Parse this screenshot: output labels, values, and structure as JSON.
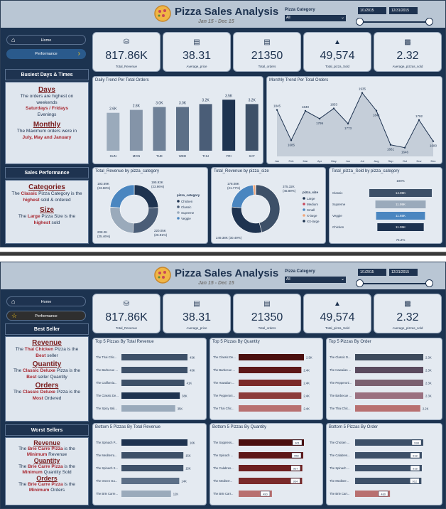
{
  "header": {
    "title": "Pizza Sales Analysis",
    "subtitle": "Jan 15 - Dec 15",
    "filter_label": "Pizza Category",
    "filter_value": "All",
    "date_start": "1/1/2015",
    "date_end": "12/31/2015"
  },
  "nav": {
    "home": "Home",
    "performance": "Performance"
  },
  "kpis": [
    {
      "value": "817.86K",
      "label": "Total_Revenue",
      "icon": "money-bag-icon"
    },
    {
      "value": "38.31",
      "label": "Average_price",
      "icon": "receipt-icon"
    },
    {
      "value": "21350",
      "label": "Total_orders",
      "icon": "clipboard-icon"
    },
    {
      "value": "49,574",
      "label": "Total_pizza_Sold",
      "icon": "pizza-slice-icon"
    },
    {
      "value": "2.32",
      "label": "Average_pizzas_sold",
      "icon": "bar-chart-icon"
    }
  ],
  "page1": {
    "side1_head": "Busiest Days & Times",
    "days_title": "Days",
    "days_text1": "The orders are highest on weekends",
    "days_red": "Saturdays / Fridays",
    "days_text2": "Evenings",
    "monthly_title": "Monthly",
    "monthly_text": "The Maximum orders were in",
    "monthly_red": "July, May and January",
    "side2_head": "Sales Performance",
    "cat_title": "Categories",
    "cat_t1": "The ",
    "cat_red1": "Classic",
    "cat_t2": " Pizza Category is the ",
    "cat_red2": "highest",
    "cat_t3": " sold & ordered",
    "size_title": "Size",
    "size_t1": "The ",
    "size_red1": "Large",
    "size_t2": " Pizza Size is the ",
    "size_red2": "highest",
    "size_t3": " sold"
  },
  "page2": {
    "side1_head": "Best Seller",
    "rev_title": "Revenue",
    "rev_t1": "The ",
    "rev_red": "Thai Chicken",
    "rev_t2": " Pizza is the ",
    "rev_red2": "Best",
    "rev_t3": " seller",
    "qty_title": "Quantity",
    "qty_t1": "The ",
    "qty_red": "Classic Deluxe",
    "qty_t2": " Pizza is the ",
    "qty_red2": "Best",
    "qty_t3": " seller Quantity",
    "ord_title": "Orders",
    "ord_t1": "The ",
    "ord_red": "Classic Deluxe",
    "ord_t2": " Pizza is the ",
    "ord_red2": "Most",
    "ord_t3": " Ordered",
    "side2_head": "Worst Sellers",
    "wrev_title": "Revenue",
    "wrev_t1": "The ",
    "wrev_red": "Brie Carre Pizza",
    "wrev_t2": " is the ",
    "wrev_red2": "Minimum",
    "wrev_t3": " Revenue",
    "wqty_title": "Quantity",
    "wqty_t1": "The ",
    "wqty_red": "Brie Carre Pizza",
    "wqty_t2": " is the ",
    "wqty_red2": "Minimum",
    "wqty_t3": " Quantity Sold",
    "word_title": "Orders",
    "word_t1": "The ",
    "word_red": "Brie Carre Pizza",
    "word_t2": " is the ",
    "word_red2": "Minimum",
    "word_t3": " Orders"
  },
  "chart_data": [
    {
      "type": "bar",
      "title": "Daily Trend Per Total Orders",
      "categories": [
        "SUN",
        "MON",
        "TUE",
        "WED",
        "THU",
        "FRI",
        "SAT"
      ],
      "values": [
        2.6,
        2.8,
        3.0,
        3.0,
        3.2,
        3.5,
        3.2
      ],
      "labels": [
        "2.6K",
        "2.8K",
        "3.0K",
        "3.0K",
        "3.2K",
        "3.5K",
        "3.2K"
      ],
      "unit": "K",
      "colors": [
        "#9aaabb",
        "#8494a8",
        "#6f8198",
        "#5c6f87",
        "#4a5d77",
        "#1e3350",
        "#3d5068"
      ]
    },
    {
      "type": "area",
      "title": "Monthly Trend Per Total Orders",
      "categories": [
        "Jan",
        "Feb",
        "Mar",
        "Apr",
        "May",
        "Jun",
        "Jul",
        "Aug",
        "Sep",
        "Oct",
        "Nov",
        "Dec"
      ],
      "values": [
        1845,
        1685,
        1840,
        1799,
        1853,
        1773,
        1935,
        1841,
        1661,
        1646,
        1792,
        1680
      ],
      "ylim": [
        1600,
        1960
      ]
    },
    {
      "type": "pie",
      "title": "Total_Revenue by pizza_category",
      "legend_title": "pizza_category",
      "legend": [
        "Chicken",
        "Classic",
        "Supreme",
        "Veggie"
      ],
      "values": [
        195.92,
        220.05,
        208.2,
        193.69
      ],
      "labels": [
        "195.92K\n(23.96%)",
        "220.05K\n(26.91%)",
        "208.2K\n(25.46%)",
        "193.69K\n(23.68%)"
      ],
      "colors": [
        "#1e3350",
        "#4a5d77",
        "#9aaabb",
        "#4a86c0"
      ]
    },
    {
      "type": "pie",
      "title": "Total_Revenue by pizza_size",
      "legend_title": "pizza_size",
      "legend": [
        "Large",
        "Medium",
        "Small",
        "X-large",
        "XX-large"
      ],
      "values": [
        375.32,
        249.38,
        178.08,
        14.08,
        1.01
      ],
      "labels": [
        "375.32K\n(45.89%)",
        "249.38K (30.49%)",
        "178.08K\n(21.77%)"
      ],
      "colors": [
        "#3d5068",
        "#1e3350",
        "#4a86c0",
        "#f0a67a",
        "#1e3350"
      ],
      "legend_colors": [
        "#1e3350",
        "#c8465a",
        "#4a86c0",
        "#f0a67a",
        "#1e3350"
      ]
    },
    {
      "type": "bar",
      "title": "Total_pizza_Sold by pizza_category",
      "categories": [
        "Classic",
        "Supreme",
        "Veggie",
        "Chicken"
      ],
      "values": [
        14.89,
        11.99,
        11.65,
        11.05
      ],
      "labels": [
        "14.89K",
        "11.99K",
        "11.65K",
        "11.05K"
      ],
      "top_label": "100%",
      "bottom_label": "74.2%",
      "colors": [
        "#3d5068",
        "#9aaabb",
        "#4a86c0",
        "#1e3350"
      ]
    },
    {
      "type": "bar",
      "title": "Top 5 Pizzas By Total Revenue",
      "categories": [
        "The Thai Chic...",
        "The Barbecue ...",
        "The California...",
        "The Classic De...",
        "The Spicy Itali..."
      ],
      "values": [
        43,
        43,
        41,
        38,
        35
      ],
      "labels": [
        "43K",
        "43K",
        "41K",
        "38K",
        "35K"
      ],
      "colors": [
        "#3d5068",
        "#3d5068",
        "#3d5068",
        "#1e3350",
        "#9aaabb"
      ]
    },
    {
      "type": "bar",
      "title": "Top 5 Pizzas By Quantity",
      "categories": [
        "The Classic De...",
        "The Barbecue ...",
        "The Hawaiian ...",
        "The Pepperoni...",
        "The Thai Chic..."
      ],
      "values": [
        2.5,
        2.4,
        2.4,
        2.4,
        2.4
      ],
      "labels": [
        "2.5K",
        "2.4K",
        "2.4K",
        "2.4K",
        "2.4K"
      ],
      "colors": [
        "#4a0f0f",
        "#5e1818",
        "#7a2a2a",
        "#8c3c3c",
        "#b87070"
      ]
    },
    {
      "type": "bar",
      "title": "Top 5 Pizzas By Order",
      "categories": [
        "The Classic D...",
        "The Hawaiian ...",
        "The Pepperoni...",
        "The Barbecue ...",
        "The Thai Chic..."
      ],
      "values": [
        2.3,
        2.3,
        2.3,
        2.3,
        2.2
      ],
      "labels": [
        "2.3K",
        "2.3K",
        "2.3K",
        "2.3K",
        "2.2K"
      ],
      "colors": [
        "#3d4a5c",
        "#5a4a5e",
        "#7a6070",
        "#9a7080",
        "#b87070"
      ]
    },
    {
      "type": "bar",
      "title": "Bottom 5 Pizzas By Total Revenue",
      "categories": [
        "The Spinach P...",
        "The Mediterra...",
        "The Spinach S...",
        "The Green Ga...",
        "The Brie Carre..."
      ],
      "values": [
        16,
        15,
        15,
        14,
        12
      ],
      "labels": [
        "16K",
        "15K",
        "15K",
        "14K",
        "12K"
      ],
      "colors": [
        "#1e3350",
        "#3d5068",
        "#3d5068",
        "#5c6f87",
        "#9aaabb"
      ]
    },
    {
      "type": "bar",
      "title": "Bottom 5 Pizzas By Quantity",
      "categories": [
        "The Soppress...",
        "The Spinach ...",
        "The Calabres...",
        "The Mediterr...",
        "The Brie Carr..."
      ],
      "values": [
        961,
        950,
        937,
        934,
        490
      ],
      "labels": [
        "961",
        "950",
        "937",
        "934",
        "490"
      ],
      "colors": [
        "#4a0f0f",
        "#5e1818",
        "#6e2020",
        "#7a2a2a",
        "#b87070"
      ]
    },
    {
      "type": "bar",
      "title": "Bottom 5 Pizzas By Order",
      "categories": [
        "The Chicken ...",
        "The Calabres...",
        "The Spinach ...",
        "The Mediterr...",
        "The Brie Carr..."
      ],
      "values": [
        938,
        918,
        918,
        912,
        480
      ],
      "labels": [
        "938",
        "918",
        "918",
        "912",
        "480"
      ],
      "colors": [
        "#3d5068",
        "#3d5068",
        "#3d5068",
        "#3d5068",
        "#b87070"
      ]
    }
  ]
}
